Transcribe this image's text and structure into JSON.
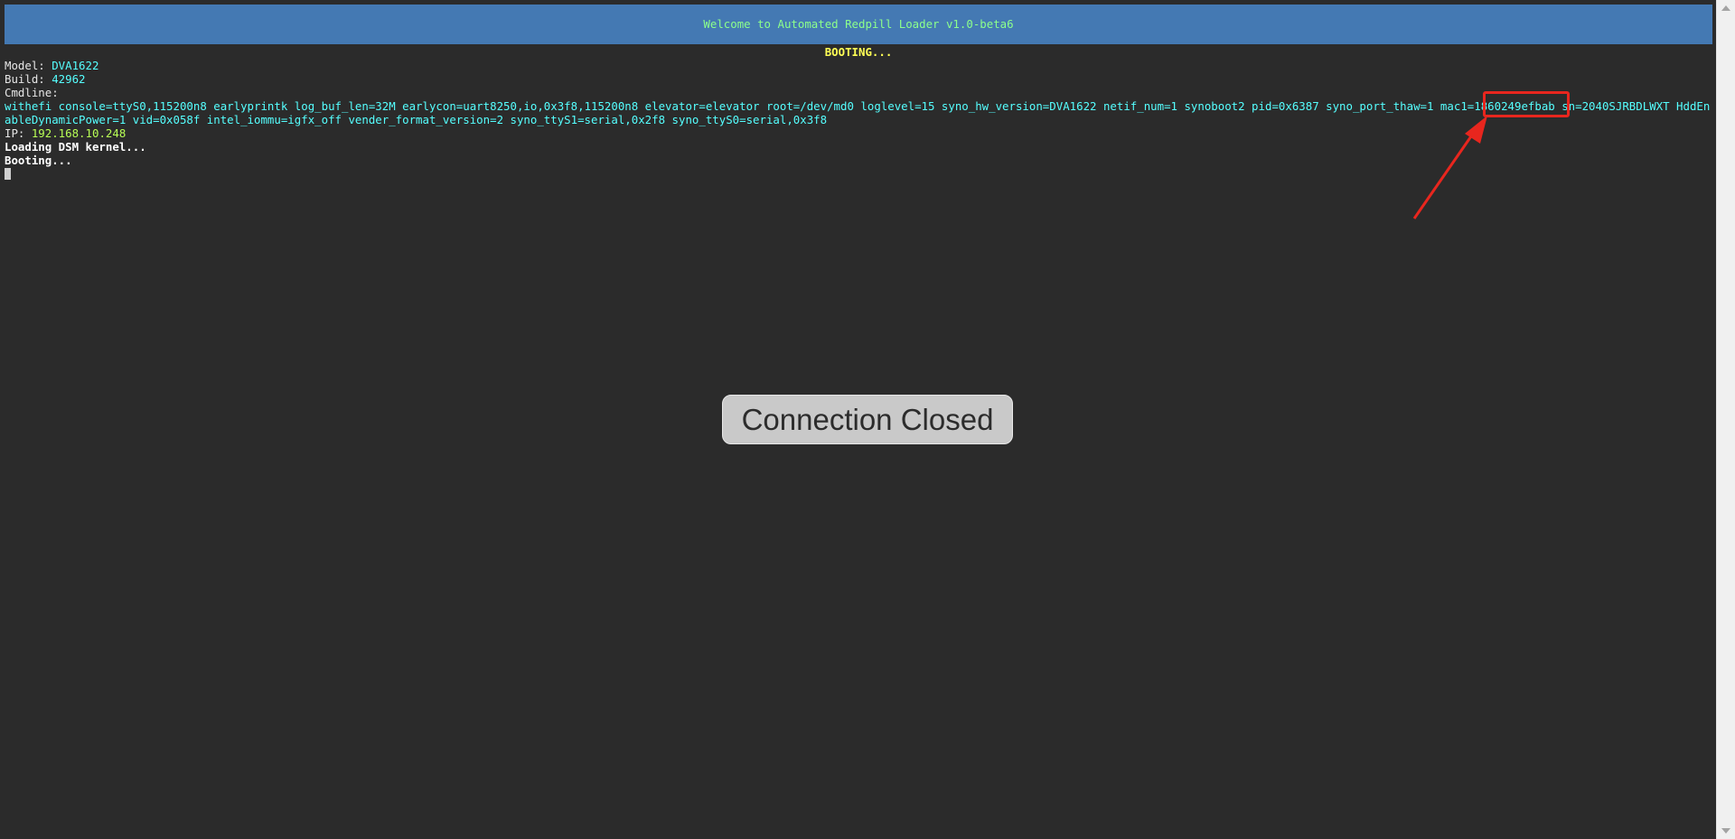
{
  "banner": {
    "text": "Welcome to Automated Redpill Loader v1.0-beta6"
  },
  "status": {
    "title": "BOOTING..."
  },
  "info": {
    "model_label": "Model: ",
    "model_value": "DVA1622",
    "build_label": "Build: ",
    "build_value": "42962",
    "cmdline_label": "Cmdline:",
    "cmdline_value": "withefi console=ttyS0,115200n8 earlyprintk log_buf_len=32M earlycon=uart8250,io,0x3f8,115200n8 elevator=elevator root=/dev/md0 loglevel=15 syno_hw_version=DVA1622 netif_num=1 synoboot2 pid=0x6387 syno_port_thaw=1 mac1=1860249efbab sn=2040SJRBDLWXT HddEnableDynamicPower=1 vid=0x058f intel_iommu=igfx_off vender_format_version=2 syno_ttyS1=serial,0x2f8 syno_ttyS0=serial,0x3f8",
    "ip_label": "IP: ",
    "ip_value": "192.168.10.248",
    "loading_text": "Loading DSM kernel...",
    "booting_text": "Booting..."
  },
  "overlay": {
    "text": "Connection Closed"
  },
  "colors": {
    "background": "#2b2b2b",
    "banner": "#4479b3",
    "banner_text": "#8cff8c",
    "cyan": "#55ffff",
    "yellow": "#ffff55",
    "annotation_red": "#e8261e"
  },
  "icons": {
    "annotation": "red-arrow-icon"
  }
}
